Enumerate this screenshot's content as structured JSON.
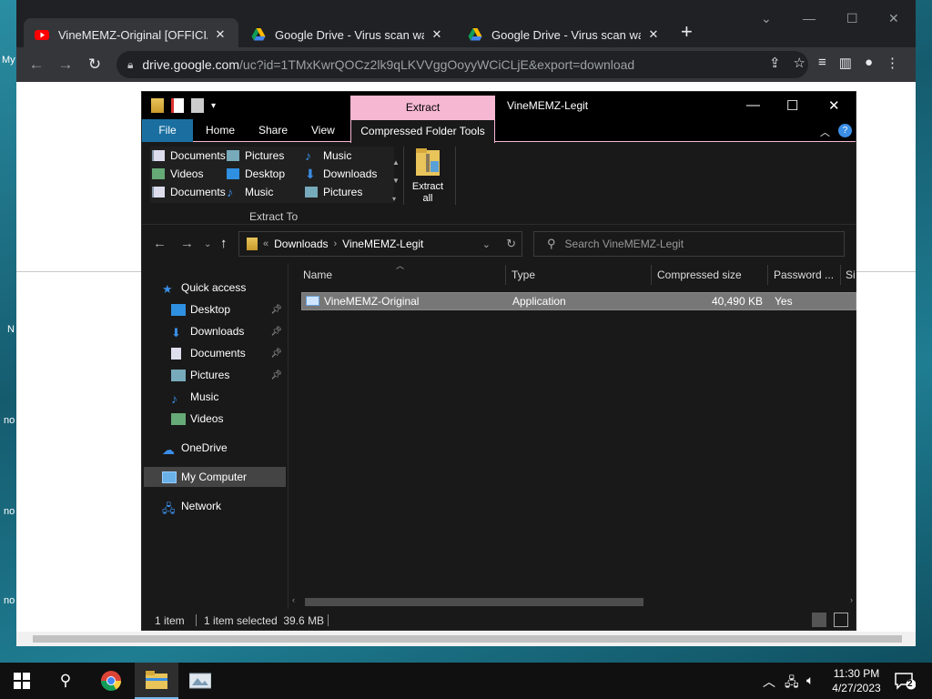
{
  "desktop": {
    "fragments": [
      "My",
      "N",
      "no",
      "no",
      "no"
    ]
  },
  "browser": {
    "tabs": [
      {
        "title": "VineMEMZ-Original [OFFICIAL] F",
        "favicon": "youtube-icon",
        "active": true
      },
      {
        "title": "Google Drive - Virus scan warnin",
        "favicon": "google-drive-icon",
        "active": false
      },
      {
        "title": "Google Drive - Virus scan warnin",
        "favicon": "google-drive-icon",
        "active": false
      }
    ],
    "url_host": "drive.google.com",
    "url_rest": "/uc?id=1TMxKwrQOCz2lk9qLKVVggOoyyWCiCLjE&export=download"
  },
  "explorer": {
    "title": "VineMEMZ-Legit",
    "context_tab": "Extract",
    "ribbon_tabs": {
      "file": "File",
      "home": "Home",
      "share": "Share",
      "view": "View",
      "tools": "Compressed Folder Tools"
    },
    "gallery": [
      [
        "Documents",
        "Pictures",
        "Music"
      ],
      [
        "Videos",
        "Desktop",
        "Downloads"
      ],
      [
        "Documents",
        "Music",
        "Pictures"
      ]
    ],
    "extract_all_label": "Extract all",
    "group_label": "Extract To",
    "breadcrumb": [
      "Downloads",
      "VineMEMZ-Legit"
    ],
    "breadcrumb_prefix": "«",
    "search_placeholder": "Search VineMEMZ-Legit",
    "nav_items": [
      {
        "label": "Quick access",
        "icon": "star-icon",
        "pinned": false
      },
      {
        "label": "Desktop",
        "icon": "desktop-icon",
        "pinned": true
      },
      {
        "label": "Downloads",
        "icon": "download-icon",
        "pinned": true
      },
      {
        "label": "Documents",
        "icon": "document-icon",
        "pinned": true
      },
      {
        "label": "Pictures",
        "icon": "pictures-icon",
        "pinned": true
      },
      {
        "label": "Music",
        "icon": "music-icon",
        "pinned": false
      },
      {
        "label": "Videos",
        "icon": "videos-icon",
        "pinned": false
      },
      {
        "label": "OneDrive",
        "icon": "cloud-icon",
        "pinned": false
      },
      {
        "label": "My Computer",
        "icon": "computer-icon",
        "pinned": false,
        "selected": true
      },
      {
        "label": "Network",
        "icon": "network-icon",
        "pinned": false
      }
    ],
    "columns": [
      "Name",
      "Type",
      "Compressed size",
      "Password ...",
      "Si"
    ],
    "files": [
      {
        "name": "VineMEMZ-Original",
        "type": "Application",
        "compressed_size": "40,490 KB",
        "password": "Yes"
      }
    ],
    "status": {
      "count": "1 item",
      "selected": "1 item selected  39.6 MB"
    }
  },
  "taskbar": {
    "time": "11:30 PM",
    "date": "4/27/2023",
    "notifications": "2"
  }
}
